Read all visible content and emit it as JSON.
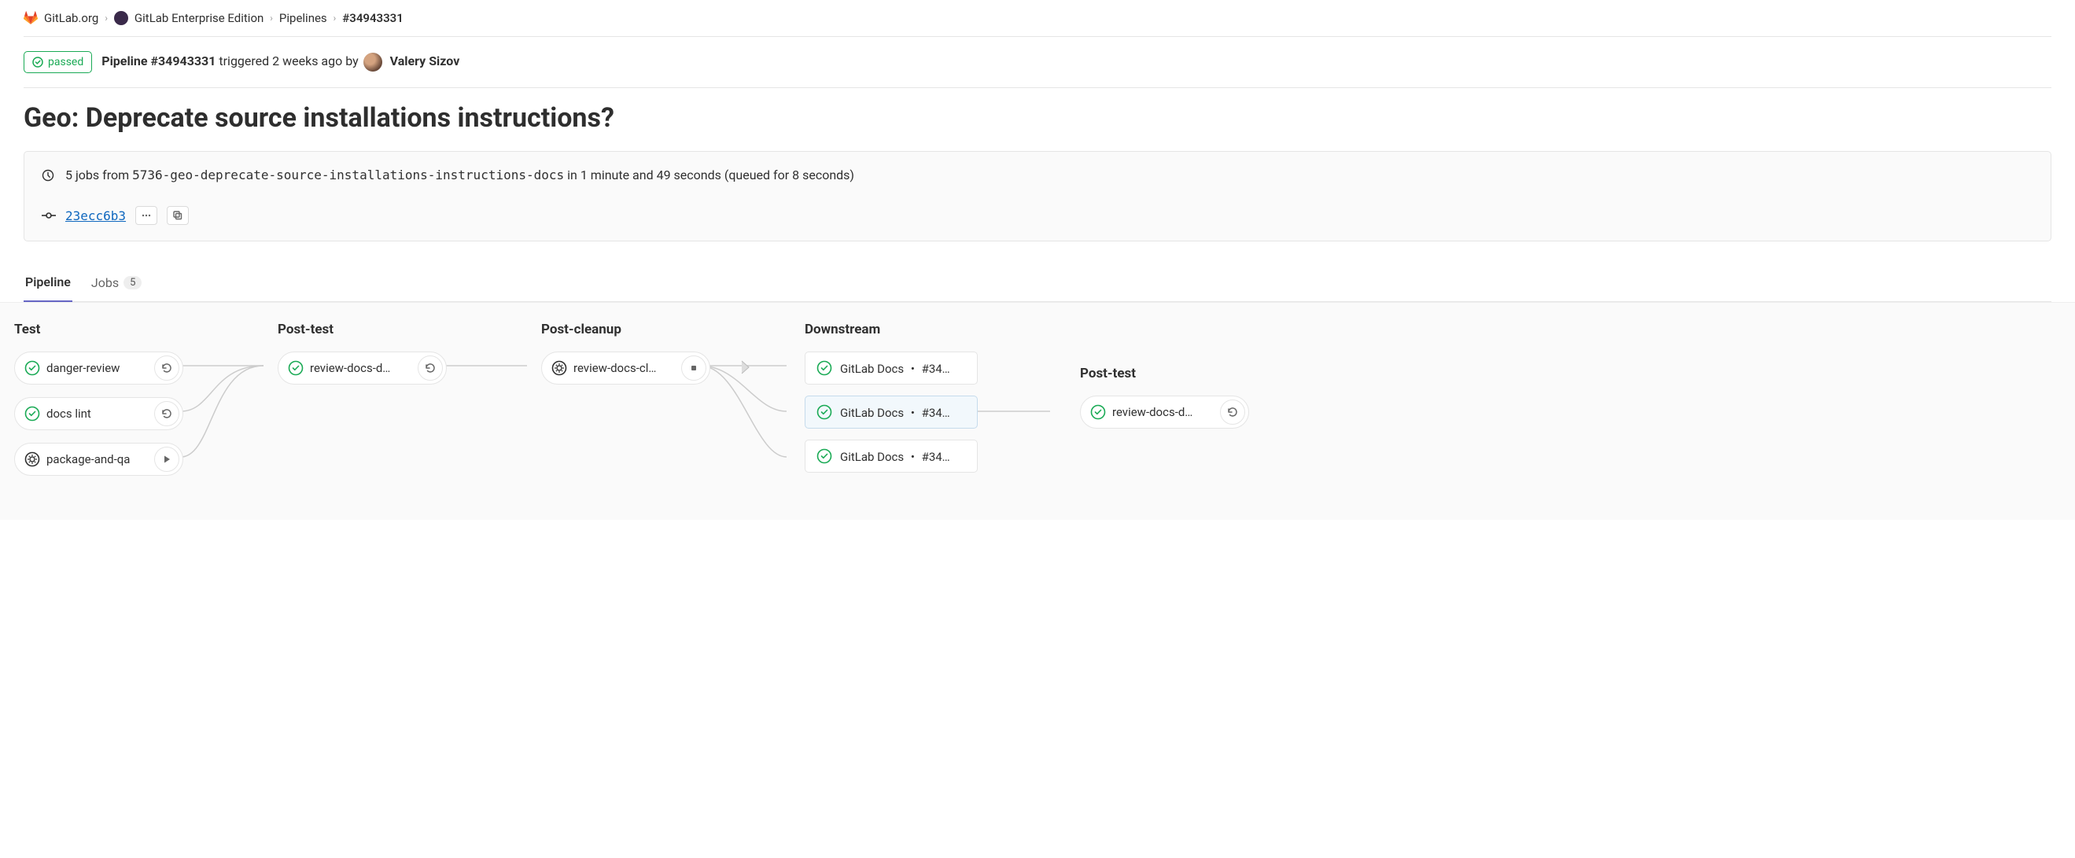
{
  "breadcrumb": {
    "org": "GitLab.org",
    "project": "GitLab Enterprise Edition",
    "section": "Pipelines",
    "current": "#34943331"
  },
  "status": {
    "badge": "passed",
    "prefix": "Pipeline ",
    "id": "#34943331",
    "middle": " triggered 2 weeks ago by ",
    "author": "Valery Sizov"
  },
  "title": "Geo: Deprecate source installations instructions?",
  "job_info": {
    "jobs_count_text": "5 jobs from ",
    "branch": "5736-geo-deprecate-source-installations-instructions-docs",
    "duration": " in 1 minute and 49 seconds (queued for 8 seconds)",
    "commit_sha": "23ecc6b3"
  },
  "tabs": {
    "pipeline": "Pipeline",
    "jobs": "Jobs",
    "jobs_count": "5"
  },
  "stages": {
    "test": {
      "title": "Test",
      "jobs": [
        {
          "name": "danger-review",
          "status": "passed",
          "action": "retry"
        },
        {
          "name": "docs lint",
          "status": "passed",
          "action": "retry"
        },
        {
          "name": "package-and-qa",
          "status": "manual",
          "action": "play"
        }
      ]
    },
    "post_test": {
      "title": "Post-test",
      "jobs": [
        {
          "name": "review-docs-d…",
          "status": "passed",
          "action": "retry"
        }
      ]
    },
    "post_cleanup": {
      "title": "Post-cleanup",
      "jobs": [
        {
          "name": "review-docs-cl…",
          "status": "manual",
          "action": "stop"
        }
      ]
    },
    "downstream": {
      "title": "Downstream",
      "items": [
        {
          "label": "GitLab Docs ・ #34…"
        },
        {
          "label": "GitLab Docs ・ #34…"
        },
        {
          "label": "GitLab Docs ・ #34…"
        }
      ]
    },
    "downstream_post_test": {
      "title": "Post-test",
      "jobs": [
        {
          "name": "review-docs-d…",
          "status": "passed",
          "action": "retry"
        }
      ]
    }
  }
}
